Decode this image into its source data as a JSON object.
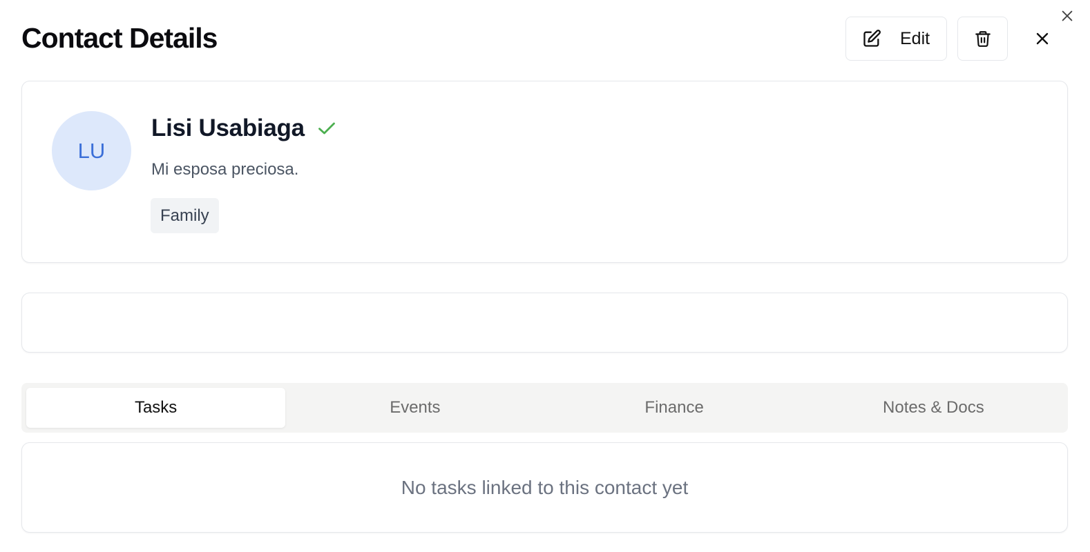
{
  "dialog": {
    "title": "Contact Details",
    "edit_label": "Edit"
  },
  "contact": {
    "initials": "LU",
    "name": "Lisi Usabiaga",
    "bio": "Mi esposa preciosa.",
    "tag": "Family",
    "verified_icon": "check-icon",
    "avatar_bg": "#dde8fb",
    "avatar_fg": "#3b6fd8",
    "verified_color": "#4caf50"
  },
  "tabs": [
    {
      "label": "Tasks",
      "active": true
    },
    {
      "label": "Events",
      "active": false
    },
    {
      "label": "Finance",
      "active": false
    },
    {
      "label": "Notes & Docs",
      "active": false
    }
  ],
  "content": {
    "empty_message": "No tasks linked to this contact yet"
  }
}
